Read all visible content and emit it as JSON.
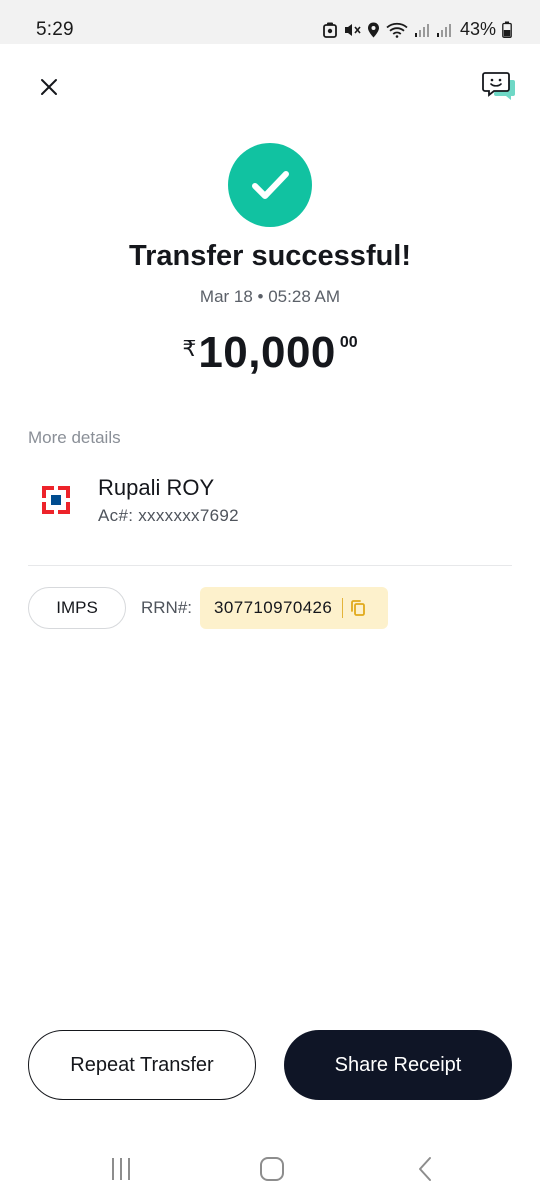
{
  "status_bar": {
    "time": "5:29",
    "battery": "43%",
    "icons": [
      "notification-icon",
      "mute-icon",
      "location-icon",
      "wifi-icon",
      "signal-icon",
      "signal-icon-2",
      "battery-icon"
    ]
  },
  "header": {
    "close_icon": "close-icon",
    "support_icon": "chat-support-icon"
  },
  "success": {
    "title": "Transfer successful!",
    "date": "Mar 18 • 05:28 AM",
    "currency_symbol": "₹",
    "amount": "10,000",
    "amount_decimal": "00",
    "accent_color": "#11c2a1"
  },
  "details": {
    "section_label": "More details",
    "recipient_name": "Rupali ROY",
    "account": "Ac#: xxxxxxx7692",
    "transfer_mode": "IMPS",
    "rrn_label": "RRN#:",
    "rrn_value": "307710970426"
  },
  "actions": {
    "repeat_label": "Repeat Transfer",
    "share_label": "Share Receipt"
  }
}
